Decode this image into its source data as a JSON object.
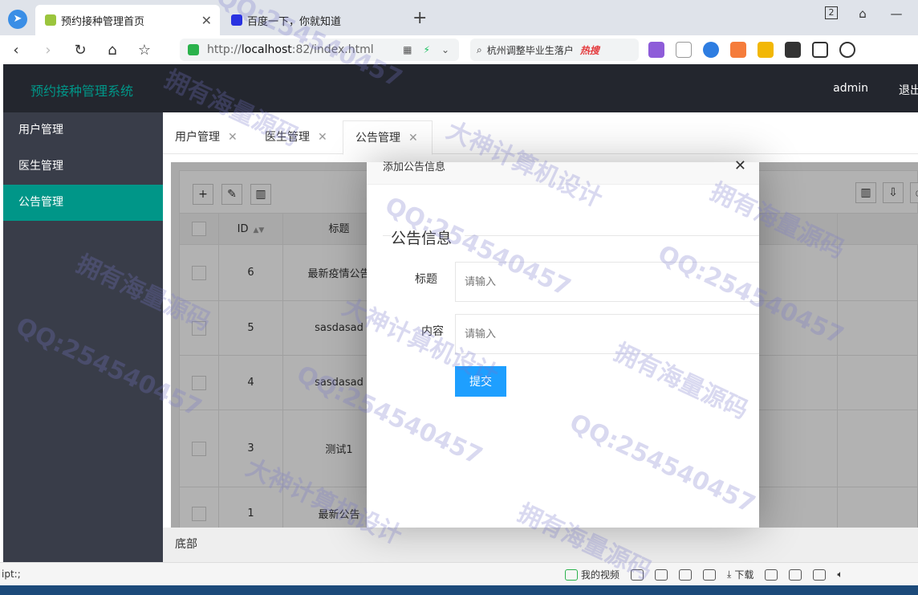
{
  "browser": {
    "tabs": [
      {
        "title": "预约接种管理首页",
        "active": true
      },
      {
        "title": "百度一下，你就知道",
        "active": false
      }
    ],
    "tab_count": "2",
    "url_prefix": "http://",
    "url_host": "localhost",
    "url_rest": ":82/index.html",
    "search_text": "杭州调整毕业生落户",
    "search_hot": "热搜"
  },
  "app": {
    "title": "预约接种管理系统",
    "user": "admin",
    "logout": "退出"
  },
  "sidebar": {
    "items": [
      {
        "label": "用户管理",
        "active": false
      },
      {
        "label": "医生管理",
        "active": false
      },
      {
        "label": "公告管理",
        "active": true
      }
    ]
  },
  "tabs": [
    {
      "label": "用户管理"
    },
    {
      "label": "医生管理"
    },
    {
      "label": "公告管理",
      "active": true
    }
  ],
  "table": {
    "columns": [
      "ID",
      "标题"
    ],
    "rows": [
      {
        "id": "6",
        "title": "最新疫情公告"
      },
      {
        "id": "5",
        "title": "sasdasad"
      },
      {
        "id": "4",
        "title": "sasdasad"
      },
      {
        "id": "3",
        "title": "测试1"
      },
      {
        "id": "1",
        "title": "最新公告"
      }
    ]
  },
  "modal": {
    "title": "添加公告信息",
    "legend": "公告信息",
    "fields": [
      {
        "label": "标题",
        "placeholder": "请输入"
      },
      {
        "label": "内容",
        "placeholder": "请输入"
      }
    ],
    "submit": "提交"
  },
  "footer": "底部",
  "statusbar": {
    "left": "ipt:;",
    "video": "我的视频",
    "download": "下载"
  },
  "watermarks": [
    "QQ:254540457",
    "拥有海量源码",
    "大神计算机设计"
  ]
}
